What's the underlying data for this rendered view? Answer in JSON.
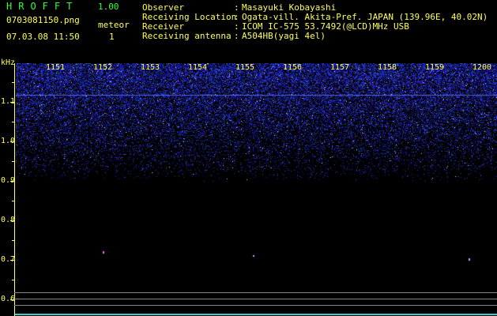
{
  "header": {
    "app_title": "HROFFT",
    "app_version": "1.00",
    "file_name": "0703081150.png",
    "meteor_label": "meteor",
    "date_time": "07.03.08 11:50",
    "meteor_count": "1"
  },
  "info": {
    "observer_label": "Observer",
    "observer_value": "Masayuki Kobayashi",
    "location_label": "Receiving Location",
    "location_value": "Ogata-vill. Akita-Pref. JAPAN (139.96E, 40.02N)",
    "receiver_label": "Receiver",
    "receiver_value": "ICOM IC-575 53.7492(@LCD)MHz USB",
    "antenna_label": "Receiving antenna",
    "antenna_value": "A504HB(yagi 4el)",
    "colon": ":"
  },
  "axis": {
    "unit": "kHz",
    "ticks": [
      "1.1",
      "1.0",
      "0.9",
      "0.8",
      "0.7",
      "0.6"
    ]
  },
  "time_axis": {
    "labels": [
      "1151",
      "1152",
      "1153",
      "1154",
      "1155",
      "1156",
      "1157",
      "1158",
      "1159",
      "1200"
    ]
  },
  "colors": {
    "label_text": "#ffff55",
    "title_text": "#33ff33",
    "noise": "#3344ff",
    "background": "#000000",
    "signal": "#33cccc"
  }
}
